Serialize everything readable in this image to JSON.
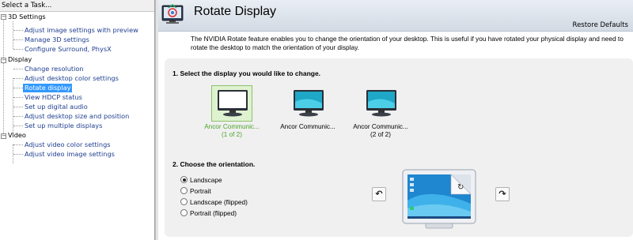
{
  "task_pane": {
    "header": "Select a Task...",
    "categories": [
      {
        "label": "3D Settings",
        "items": [
          "Adjust image settings with preview",
          "Manage 3D settings",
          "Configure Surround, PhysX"
        ]
      },
      {
        "label": "Display",
        "items": [
          "Change resolution",
          "Adjust desktop color settings",
          "Rotate display",
          "View HDCP status",
          "Set up digital audio",
          "Adjust desktop size and position",
          "Set up multiple displays"
        ]
      },
      {
        "label": "Video",
        "items": [
          "Adjust video color settings",
          "Adjust video image settings"
        ]
      }
    ],
    "selected_item": "Rotate display"
  },
  "header": {
    "title": "Rotate Display",
    "restore_defaults": "Restore Defaults",
    "icon": "rotate-display-icon"
  },
  "description": "The NVIDIA Rotate feature enables you to change the orientation of your desktop. This is useful if you have rotated your physical display and need to rotate the desktop to match the orientation of your display.",
  "section1": {
    "title": "1. Select the display you would like to change.",
    "displays": [
      {
        "name": "Ancor Communic...",
        "sub": "(1 of 2)",
        "selected": true
      },
      {
        "name": "Ancor Communic...",
        "sub": "",
        "selected": false
      },
      {
        "name": "Ancor Communic...",
        "sub": "(2 of 2)",
        "selected": false
      }
    ]
  },
  "section2": {
    "title": "2. Choose the orientation.",
    "options": [
      "Landscape",
      "Portrait",
      "Landscape (flipped)",
      "Portrait (flipped)"
    ],
    "selected": "Landscape",
    "rotate_left_icon": "rotate-left-icon",
    "rotate_right_icon": "rotate-right-icon"
  },
  "colors": {
    "selection": "#3399ff",
    "link": "#1f3f8f",
    "selected_display_text": "#4aa52a",
    "panel_bg": "#f0f0f0"
  }
}
